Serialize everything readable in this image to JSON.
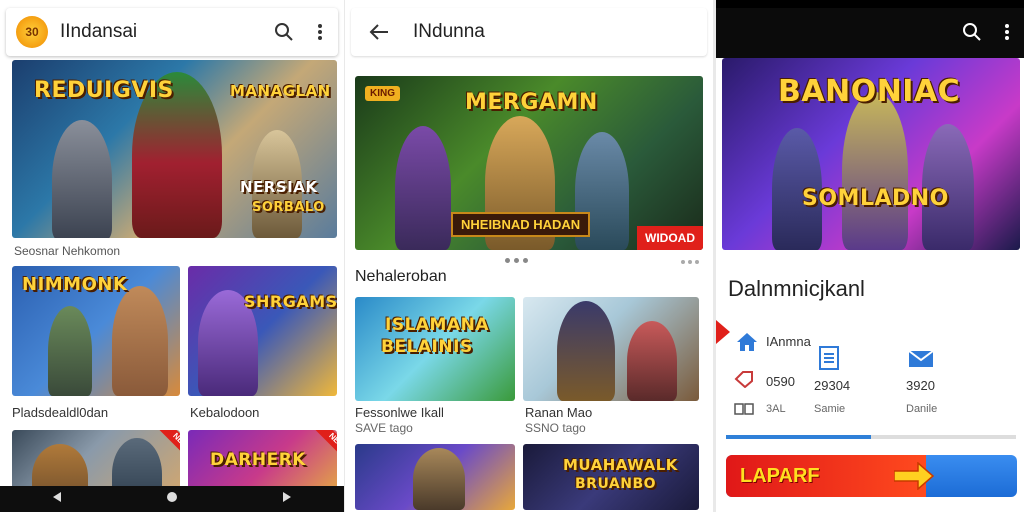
{
  "panel1": {
    "app_title": "IIndansai",
    "logo_text": "30",
    "banner": {
      "title_left": "REDUIGVIS",
      "title_right": "MANAGLAN",
      "sub_badge": "NERSIAK",
      "sub_badge2": "SORBALO"
    },
    "banner_caption": "Seosnar Nehkomon",
    "tiles": [
      {
        "title": "NIMMONK",
        "caption": "Pladsdealdl0dan"
      },
      {
        "title": "SHRGAMS",
        "caption": "Kebalodoon"
      },
      {
        "title": "",
        "caption": ""
      },
      {
        "title": "DARHERK",
        "caption": ""
      }
    ],
    "ribbon_label": "NEW"
  },
  "panel2": {
    "app_title": "INdunna",
    "banner": {
      "title": "MERGAMN",
      "badge": "KING",
      "bottom_text": "NHEIBNAD HADAN",
      "corner_text": "WIDOAD"
    },
    "section_title": "Nehaleroban",
    "tiles": [
      {
        "title": "ISLAMANA",
        "subtitle": "BELAINIS",
        "caption": "Fessonlwe Ikall",
        "sub": "SAVE tago"
      },
      {
        "title": "",
        "caption": "Ranan Mao",
        "sub": "SSNO tago"
      },
      {
        "title": "",
        "caption": "",
        "sub": ""
      },
      {
        "title": "MUAHAWALK",
        "subtitle": "BRUANBO",
        "caption": "",
        "sub": ""
      }
    ]
  },
  "panel3": {
    "banner": {
      "title": "BANONIAC",
      "subtitle": "SOMLADNO"
    },
    "heading": "Dalnmnicjkanl",
    "row1": {
      "label": "IAnmna"
    },
    "stats": [
      {
        "value": "0590",
        "label": "3AL"
      },
      {
        "value": "29304",
        "label": "Samie"
      },
      {
        "value": "3920",
        "label": "Danile"
      }
    ],
    "progress": 0.5,
    "cta_label": "LAPARF"
  },
  "colors": {
    "accent_blue": "#2f80d8",
    "cta_red": "#e01818",
    "title_gold": "#ffd23a"
  }
}
